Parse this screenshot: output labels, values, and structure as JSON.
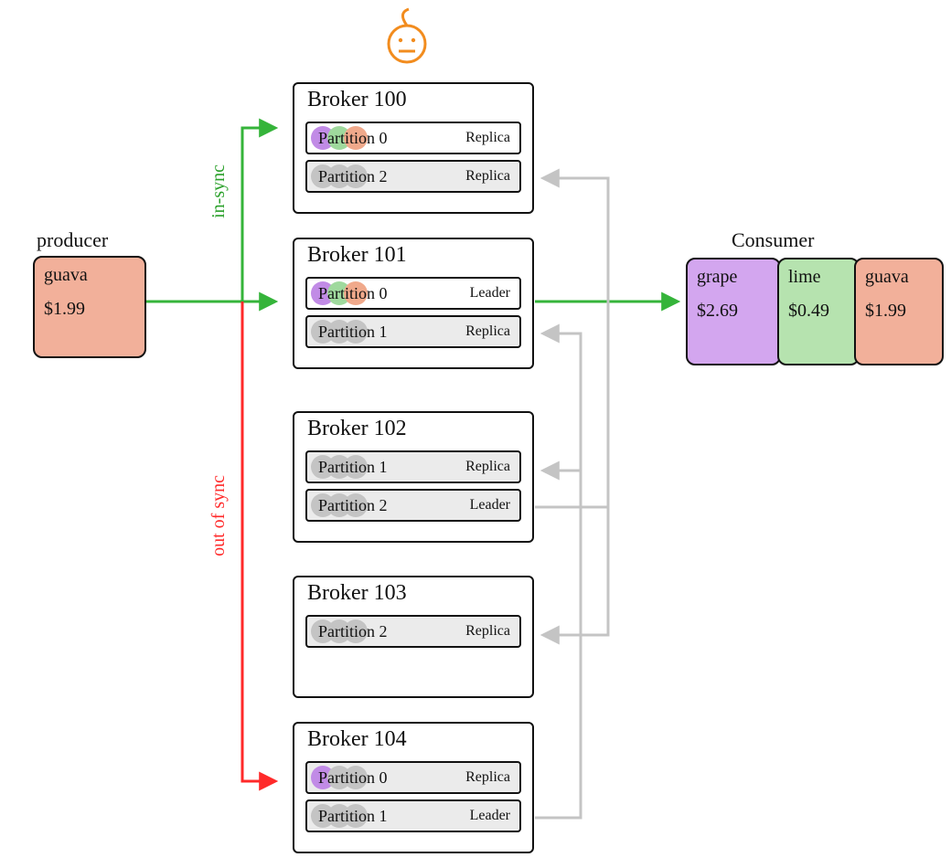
{
  "producer": {
    "label": "producer",
    "item": "guava",
    "price": "$1.99"
  },
  "consumer": {
    "label": "Consumer",
    "items": [
      {
        "name": "grape",
        "price": "$2.69",
        "color": "purple"
      },
      {
        "name": "lime",
        "price": "$0.49",
        "color": "green"
      },
      {
        "name": "guava",
        "price": "$1.99",
        "color": "orange"
      }
    ]
  },
  "sync_labels": {
    "in_sync": "in-sync",
    "out_of_sync": "out of sync"
  },
  "brokers": [
    {
      "title": "Broker 100",
      "partitions": [
        {
          "name": "Partition 0",
          "role": "Replica",
          "dots": [
            "purple",
            "green",
            "orange"
          ],
          "ghost": false
        },
        {
          "name": "Partition 2",
          "role": "Replica",
          "dots": [
            "gray",
            "gray",
            "gray"
          ],
          "ghost": true
        }
      ]
    },
    {
      "title": "Broker 101",
      "partitions": [
        {
          "name": "Partition 0",
          "role": "Leader",
          "dots": [
            "purple",
            "green",
            "orange"
          ],
          "ghost": false
        },
        {
          "name": "Partition 1",
          "role": "Replica",
          "dots": [
            "gray",
            "gray",
            "gray"
          ],
          "ghost": true
        }
      ]
    },
    {
      "title": "Broker 102",
      "partitions": [
        {
          "name": "Partition 1",
          "role": "Replica",
          "dots": [
            "gray",
            "gray",
            "gray"
          ],
          "ghost": true
        },
        {
          "name": "Partition 2",
          "role": "Leader",
          "dots": [
            "gray",
            "gray",
            "gray"
          ],
          "ghost": true
        }
      ]
    },
    {
      "title": "Broker 103",
      "partitions": [
        {
          "name": "Partition 2",
          "role": "Replica",
          "dots": [
            "gray",
            "gray",
            "gray"
          ],
          "ghost": true
        }
      ]
    },
    {
      "title": "Broker 104",
      "partitions": [
        {
          "name": "Partition 0",
          "role": "Replica",
          "dots": [
            "purple",
            "gray",
            "gray"
          ],
          "ghost": true
        },
        {
          "name": "Partition 1",
          "role": "Leader",
          "dots": [
            "gray",
            "gray",
            "gray"
          ],
          "ghost": true
        }
      ]
    }
  ],
  "colors": {
    "green": "#35b43a",
    "red": "#ff2a2a",
    "gray": "#c4c4c4",
    "orange_face": "#f28c1e"
  }
}
